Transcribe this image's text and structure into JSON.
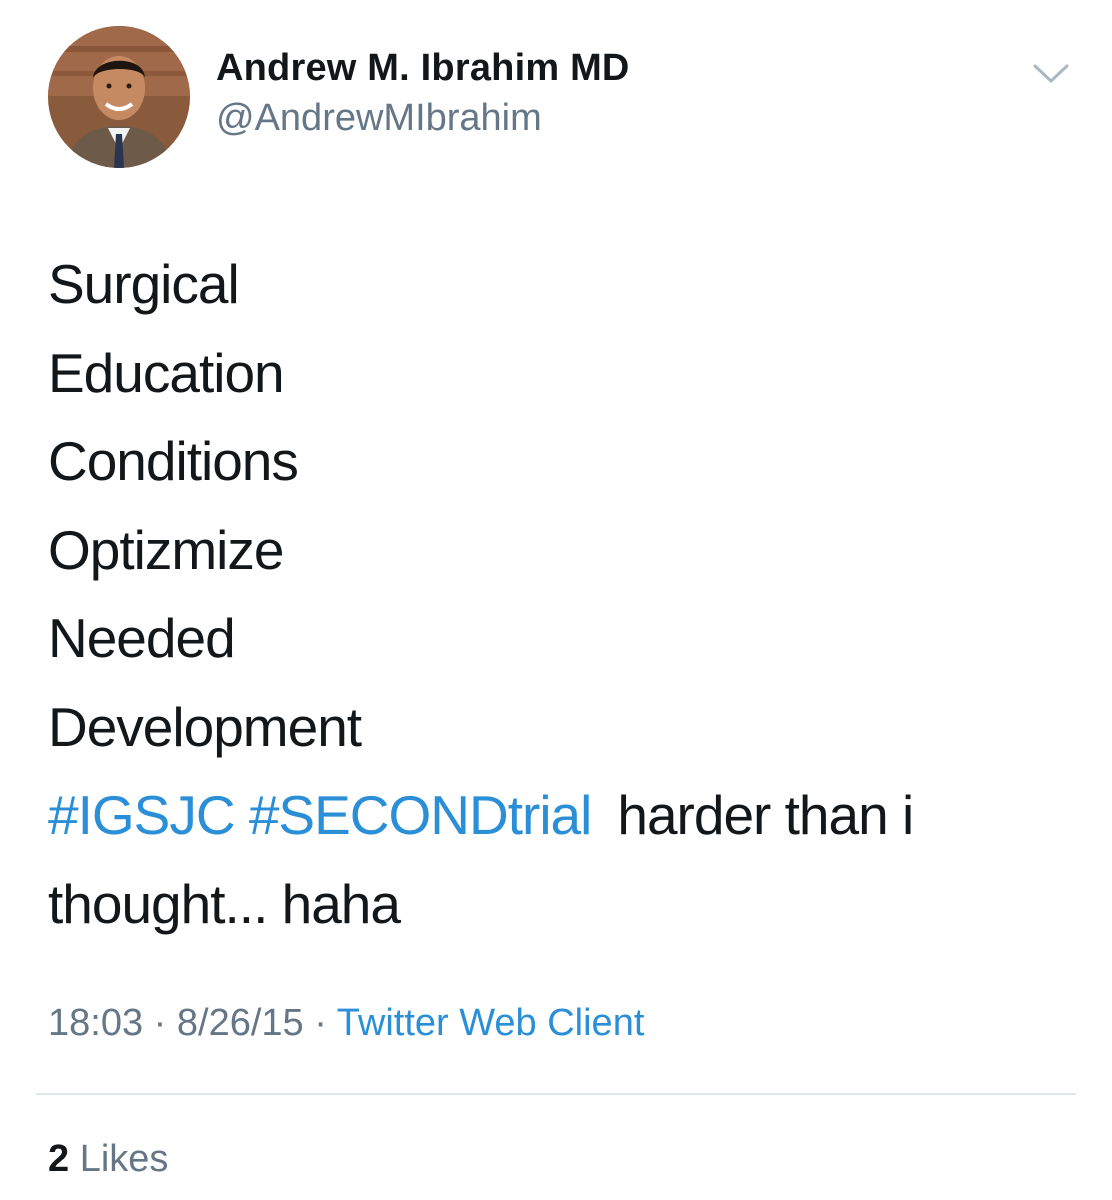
{
  "author": {
    "display_name": "Andrew M. Ibrahim MD",
    "handle": "@AndrewMIbrahim",
    "avatar": "profile-photo"
  },
  "menu": {
    "icon": "chevron-down-icon"
  },
  "tweet": {
    "lines": [
      "Surgical",
      "Education",
      "Conditions",
      "Optizmize",
      "Needed",
      "Development"
    ],
    "hashtags": [
      "#IGSJC",
      "#SECONDtrial"
    ],
    "text_after_hashtags": "harder than i",
    "last_line": "thought... haha"
  },
  "meta": {
    "time": "18:03",
    "separator": "·",
    "date": "8/26/15",
    "source": "Twitter Web Client"
  },
  "stats": {
    "likes_count": "2",
    "likes_label": "Likes"
  },
  "colors": {
    "link": "#2b8fd8",
    "secondary_text": "#657786",
    "primary_text": "#14171a",
    "divider": "#e1e8ed"
  }
}
